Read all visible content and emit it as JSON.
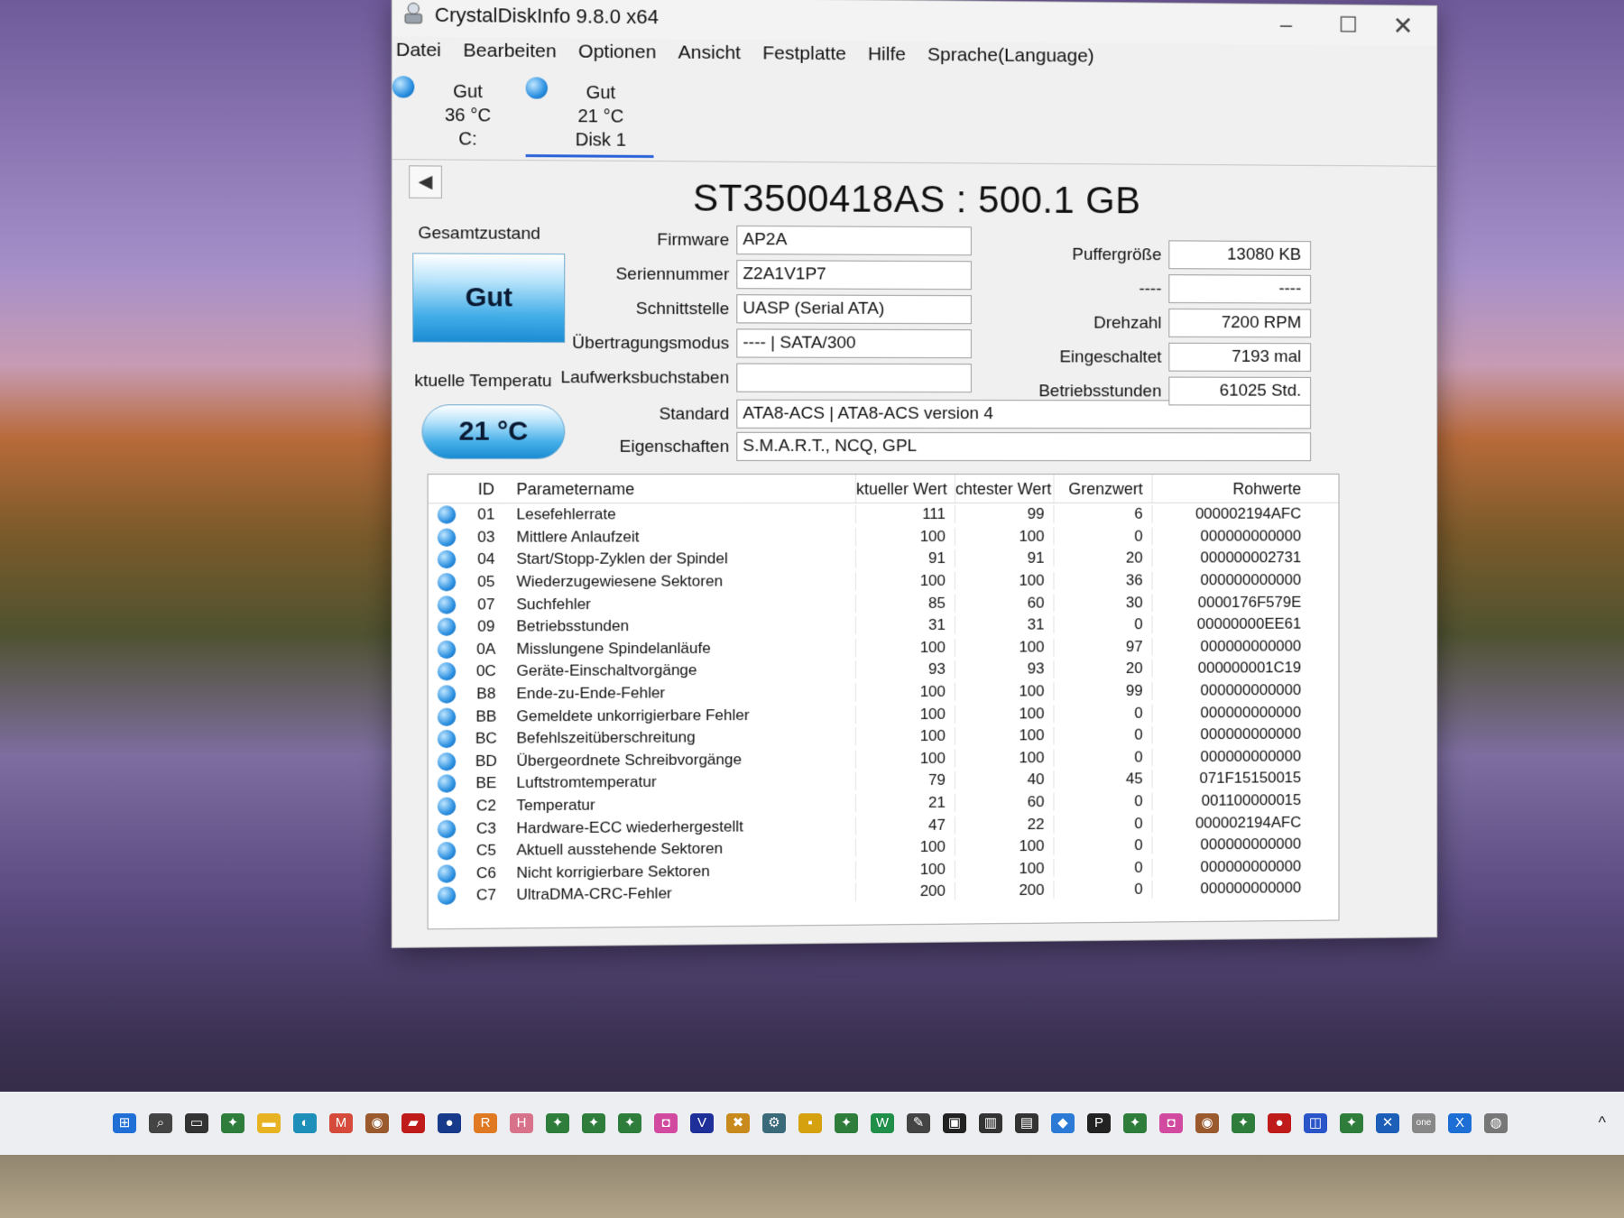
{
  "window": {
    "title": "CrystalDiskInfo 9.8.0 x64",
    "controls": {
      "minimize": "–",
      "maximize": "☐",
      "close": "✕"
    }
  },
  "menu": [
    "Datei",
    "Bearbeiten",
    "Optionen",
    "Ansicht",
    "Festplatte",
    "Hilfe",
    "Sprache(Language)"
  ],
  "disk_tabs": [
    {
      "status": "Gut",
      "temp": "36 °C",
      "name": "C:"
    },
    {
      "status": "Gut",
      "temp": "21 °C",
      "name": "Disk 1"
    }
  ],
  "nav_arrow": "◀",
  "model": "ST3500418AS : 500.1 GB",
  "health": {
    "label": "Gesamtzustand",
    "value": "Gut"
  },
  "temperature": {
    "label": "ktuelle Temperatu",
    "value": "21 °C"
  },
  "fields": {
    "firmware": {
      "label": "Firmware",
      "value": "AP2A"
    },
    "serial": {
      "label": "Seriennummer",
      "value": "Z2A1V1P7"
    },
    "interface": {
      "label": "Schnittstelle",
      "value": "UASP (Serial ATA)"
    },
    "transfer_mode": {
      "label": "Übertragungsmodus",
      "value": "---- | SATA/300"
    },
    "drive_letter": {
      "label": "Laufwerksbuchstaben",
      "value": ""
    },
    "standard": {
      "label": "Standard",
      "value": "ATA8-ACS | ATA8-ACS version 4"
    },
    "features": {
      "label": "Eigenschaften",
      "value": "S.M.A.R.T., NCQ, GPL"
    }
  },
  "right_fields": {
    "buffer": {
      "label": "Puffergröße",
      "value": "13080 KB"
    },
    "unknown": {
      "label": "----",
      "value": "----"
    },
    "rpm": {
      "label": "Drehzahl",
      "value": "7200 RPM"
    },
    "power_on_count": {
      "label": "Eingeschaltet",
      "value": "7193 mal"
    },
    "power_on_hours": {
      "label": "Betriebsstunden",
      "value": "61025 Std."
    }
  },
  "smart": {
    "headers": {
      "id": "ID",
      "name": "Parametername",
      "current": "ktueller Wert",
      "worst": "chtester Wert",
      "threshold": "Grenzwert",
      "raw": "Rohwerte"
    },
    "rows": [
      {
        "id": "01",
        "name": "Lesefehlerrate",
        "current": "111",
        "worst": "99",
        "threshold": "6",
        "raw": "000002194AFC"
      },
      {
        "id": "03",
        "name": "Mittlere Anlaufzeit",
        "current": "100",
        "worst": "100",
        "threshold": "0",
        "raw": "000000000000"
      },
      {
        "id": "04",
        "name": "Start/Stopp-Zyklen der Spindel",
        "current": "91",
        "worst": "91",
        "threshold": "20",
        "raw": "000000002731"
      },
      {
        "id": "05",
        "name": "Wiederzugewiesene Sektoren",
        "current": "100",
        "worst": "100",
        "threshold": "36",
        "raw": "000000000000"
      },
      {
        "id": "07",
        "name": "Suchfehler",
        "current": "85",
        "worst": "60",
        "threshold": "30",
        "raw": "0000176F579E"
      },
      {
        "id": "09",
        "name": "Betriebsstunden",
        "current": "31",
        "worst": "31",
        "threshold": "0",
        "raw": "00000000EE61"
      },
      {
        "id": "0A",
        "name": "Misslungene Spindelanläufe",
        "current": "100",
        "worst": "100",
        "threshold": "97",
        "raw": "000000000000"
      },
      {
        "id": "0C",
        "name": "Geräte-Einschaltvorgänge",
        "current": "93",
        "worst": "93",
        "threshold": "20",
        "raw": "000000001C19"
      },
      {
        "id": "B8",
        "name": "Ende-zu-Ende-Fehler",
        "current": "100",
        "worst": "100",
        "threshold": "99",
        "raw": "000000000000"
      },
      {
        "id": "BB",
        "name": "Gemeldete unkorrigierbare Fehler",
        "current": "100",
        "worst": "100",
        "threshold": "0",
        "raw": "000000000000"
      },
      {
        "id": "BC",
        "name": "Befehlszeitüberschreitung",
        "current": "100",
        "worst": "100",
        "threshold": "0",
        "raw": "000000000000"
      },
      {
        "id": "BD",
        "name": "Übergeordnete Schreibvorgänge",
        "current": "100",
        "worst": "100",
        "threshold": "0",
        "raw": "000000000000"
      },
      {
        "id": "BE",
        "name": "Luftstromtemperatur",
        "current": "79",
        "worst": "40",
        "threshold": "45",
        "raw": "071F15150015"
      },
      {
        "id": "C2",
        "name": "Temperatur",
        "current": "21",
        "worst": "60",
        "threshold": "0",
        "raw": "001100000015"
      },
      {
        "id": "C3",
        "name": "Hardware-ECC wiederhergestellt",
        "current": "47",
        "worst": "22",
        "threshold": "0",
        "raw": "000002194AFC"
      },
      {
        "id": "C5",
        "name": "Aktuell ausstehende Sektoren",
        "current": "100",
        "worst": "100",
        "threshold": "0",
        "raw": "000000000000"
      },
      {
        "id": "C6",
        "name": "Nicht korrigierbare Sektoren",
        "current": "100",
        "worst": "100",
        "threshold": "0",
        "raw": "000000000000"
      },
      {
        "id": "C7",
        "name": "UltraDMA-CRC-Fehler",
        "current": "200",
        "worst": "200",
        "threshold": "0",
        "raw": "000000000000"
      }
    ]
  },
  "taskbar": {
    "icons": [
      {
        "name": "start-icon",
        "color": "#1f6fd6",
        "glyph": "⊞"
      },
      {
        "name": "search-icon",
        "color": "#444444",
        "glyph": "⌕"
      },
      {
        "name": "taskview-icon",
        "color": "#333333",
        "glyph": "▭"
      },
      {
        "name": "app-icon-1",
        "color": "#2f7d3b",
        "glyph": "✦"
      },
      {
        "name": "explorer-icon",
        "color": "#e8b323",
        "glyph": "▬"
      },
      {
        "name": "edge-icon",
        "color": "#1d8fb8",
        "glyph": "◐"
      },
      {
        "name": "gmail-icon",
        "color": "#d54a3a",
        "glyph": "M"
      },
      {
        "name": "app-icon-2",
        "color": "#9a5a2e",
        "glyph": "◉"
      },
      {
        "name": "app-icon-3",
        "color": "#c01b1b",
        "glyph": "▰"
      },
      {
        "name": "app-icon-4",
        "color": "#173a8a",
        "glyph": "●"
      },
      {
        "name": "app-icon-5",
        "color": "#e07a22",
        "glyph": "R"
      },
      {
        "name": "app-icon-6",
        "color": "#d8728a",
        "glyph": "H"
      },
      {
        "name": "app-icon-7",
        "color": "#2f7d3b",
        "glyph": "✦"
      },
      {
        "name": "app-icon-8",
        "color": "#2f7d3b",
        "glyph": "✦"
      },
      {
        "name": "app-icon-9",
        "color": "#2f7d3b",
        "glyph": "✦"
      },
      {
        "name": "app-icon-10",
        "color": "#d14aa0",
        "glyph": "◘"
      },
      {
        "name": "app-icon-11",
        "color": "#1e2f9a",
        "glyph": "V"
      },
      {
        "name": "app-icon-12",
        "color": "#c98a1d",
        "glyph": "✖"
      },
      {
        "name": "app-icon-13",
        "color": "#3a6a7a",
        "glyph": "⚙"
      },
      {
        "name": "app-icon-14",
        "color": "#d6a10f",
        "glyph": "▪"
      },
      {
        "name": "app-icon-15",
        "color": "#2f7d3b",
        "glyph": "✦"
      },
      {
        "name": "app-icon-16",
        "color": "#1f8f4a",
        "glyph": "W"
      },
      {
        "name": "app-icon-17",
        "color": "#444444",
        "glyph": "✎"
      },
      {
        "name": "app-icon-18",
        "color": "#222222",
        "glyph": "▣"
      },
      {
        "name": "app-icon-19",
        "color": "#333333",
        "glyph": "▥"
      },
      {
        "name": "app-icon-20",
        "color": "#333333",
        "glyph": "▤"
      },
      {
        "name": "app-icon-21",
        "color": "#2a7ad6",
        "glyph": "◆"
      },
      {
        "name": "app-icon-22",
        "color": "#222222",
        "glyph": "P"
      },
      {
        "name": "app-icon-23",
        "color": "#2f7d3b",
        "glyph": "✦"
      },
      {
        "name": "app-icon-24",
        "color": "#d14aa0",
        "glyph": "◘"
      },
      {
        "name": "app-icon-25",
        "color": "#9a5a2e",
        "glyph": "◉"
      },
      {
        "name": "app-icon-26",
        "color": "#2f7d3b",
        "glyph": "✦"
      },
      {
        "name": "app-icon-27",
        "color": "#c01b1b",
        "glyph": "●"
      },
      {
        "name": "app-icon-28",
        "color": "#2a55c9",
        "glyph": "◫"
      },
      {
        "name": "app-icon-29",
        "color": "#2f7d3b",
        "glyph": "✦"
      },
      {
        "name": "app-icon-30",
        "color": "#1d5fb8",
        "glyph": "✕"
      },
      {
        "name": "app-icon-31",
        "color": "#888888",
        "glyph": "one"
      },
      {
        "name": "app-icon-32",
        "color": "#1d6fd6",
        "glyph": "X"
      },
      {
        "name": "crystaldiskinfo-icon",
        "color": "#777777",
        "glyph": "◍"
      }
    ],
    "tray_chevron": "^"
  }
}
